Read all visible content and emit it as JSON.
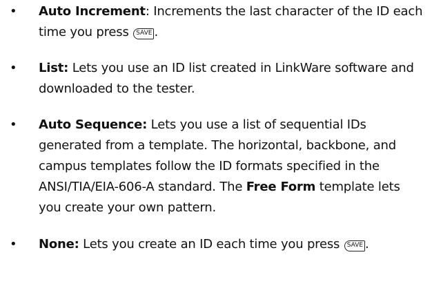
{
  "items": [
    {
      "bullet": "•",
      "title": "Auto Increment",
      "text_1": ": Increments the last character of the ID each time you press ",
      "key": "SAVE",
      "text_2": "."
    },
    {
      "bullet": "•",
      "title": "List:",
      "text_1": " Lets you use an ID list created in LinkWare software and downloaded to the tester."
    },
    {
      "bullet": "•",
      "title": "Auto Sequence:",
      "text_1": " Lets you use a list of sequential IDs generated from a template. The horizontal, backbone, and campus templates follow the ID formats specified in the ANSI/TIA/EIA-606-A standard. The ",
      "title_2": "Free Form",
      "text_2": " template lets you create your own pattern."
    },
    {
      "bullet": "•",
      "title": "None:",
      "text_1": " Lets you create an ID each time you press ",
      "key": "SAVE",
      "text_2": "."
    }
  ]
}
